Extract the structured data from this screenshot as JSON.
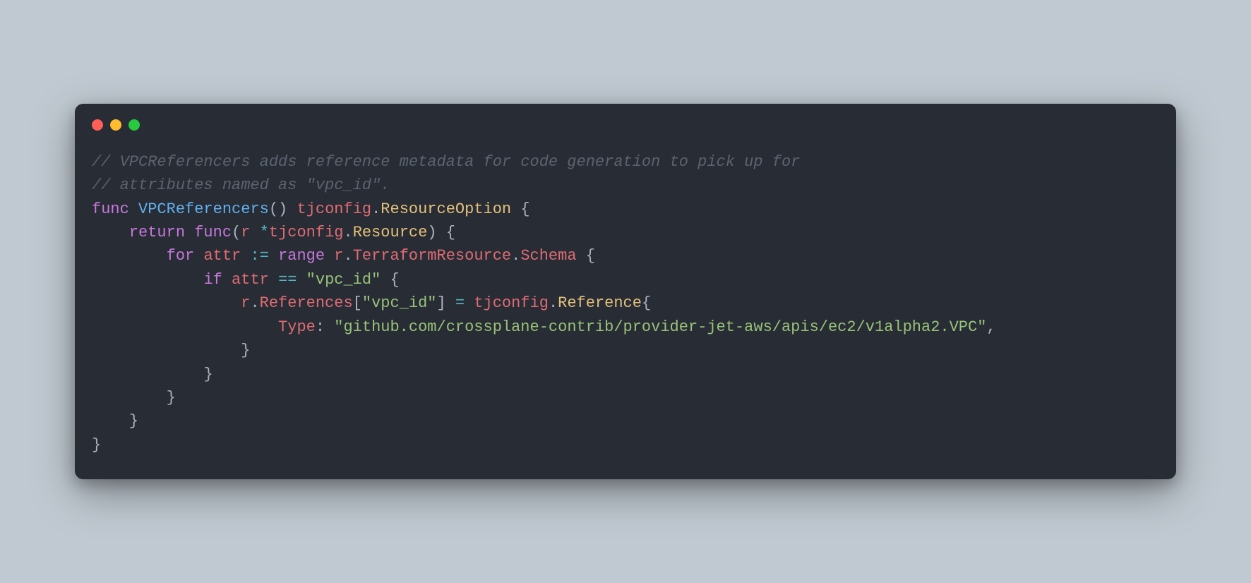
{
  "colors": {
    "page_bg": "#c0c9d1",
    "editor_bg": "#282c34",
    "comment": "#5c6370",
    "keyword": "#c678dd",
    "function": "#61afef",
    "type": "#e5c07b",
    "operator": "#56b6c2",
    "string": "#98c379",
    "ident": "#e06c75",
    "punct_fg": "#abb2bf",
    "tl_red": "#ff5f56",
    "tl_yellow": "#ffbd2e",
    "tl_green": "#27c93f"
  },
  "code": {
    "comment1": "// VPCReferencers adds reference metadata for code generation to pick up for",
    "comment2": "// attributes named as \"vpc_id\".",
    "kw_func1": "func",
    "fn_name": "VPCReferencers",
    "lp1": "() ",
    "ret_ns": "tjconfig",
    "dot1": ".",
    "ret_ty": "ResourceOption",
    "sp_ob1": " {",
    "indent1": "    ",
    "kw_return": "return",
    "sp2": " ",
    "kw_func2": "func",
    "lp2": "(",
    "param_r": "r",
    "sp_star": " ",
    "star": "*",
    "param_ns": "tjconfig",
    "dot2": ".",
    "param_ty": "Resource",
    "rp_ob2": ") {",
    "indent2": "        ",
    "kw_for": "for",
    "sp3": " ",
    "var_attr": "attr",
    "sp4": " ",
    "op_decl": ":=",
    "sp5": " ",
    "kw_range": "range",
    "sp6": " ",
    "r1": "r",
    "dot3": ".",
    "prop_tr": "TerraformResource",
    "dot4": ".",
    "prop_schema": "Schema",
    "sp_ob3": " {",
    "indent3": "            ",
    "kw_if": "if",
    "sp7": " ",
    "var_attr2": "attr",
    "sp8": " ",
    "op_eq": "==",
    "sp9": " ",
    "str_vpc1": "\"vpc_id\"",
    "sp_ob4": " {",
    "indent4": "                ",
    "r2": "r",
    "dot5": ".",
    "prop_refs": "References",
    "lb": "[",
    "str_vpc2": "\"vpc_id\"",
    "rb_sp": "] ",
    "op_assign": "=",
    "sp10": " ",
    "ns3": "tjconfig",
    "dot6": ".",
    "ty_ref": "Reference",
    "ob5": "{",
    "indent5": "                    ",
    "field_type": "Type",
    "colon_sp": ": ",
    "str_path": "\"github.com/crossplane-contrib/provider-jet-aws/apis/ec2/v1alpha2.VPC\"",
    "comma": ",",
    "indent4b": "                ",
    "cb5": "}",
    "indent3b": "            ",
    "cb4": "}",
    "indent2b": "        ",
    "cb3": "}",
    "indent1b": "    ",
    "cb2": "}",
    "cb1": "}"
  }
}
